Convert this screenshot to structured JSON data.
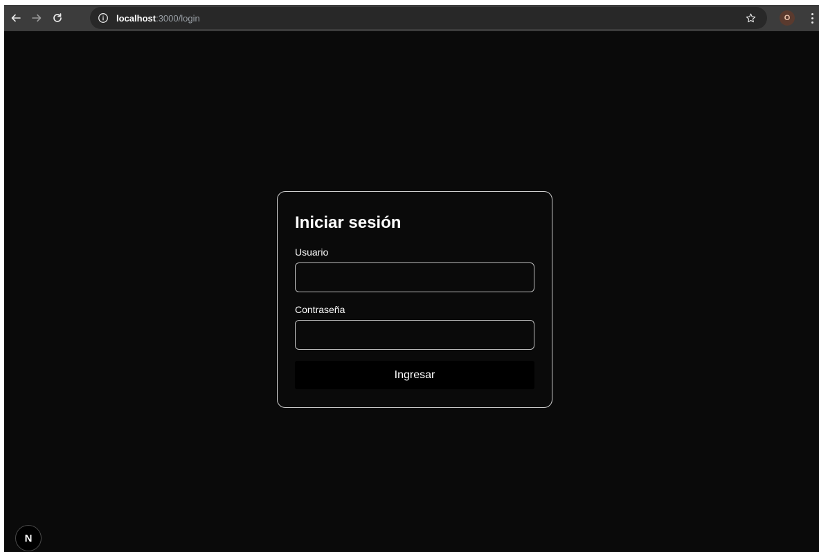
{
  "browser": {
    "url_host": "localhost",
    "url_path": ":3000/login",
    "profile_initial": "O",
    "colors": {
      "toolbar": "#3c3c3c",
      "omnibox": "#282828",
      "profile": "#5a3a2e"
    },
    "icons": [
      "back-arrow-icon",
      "forward-arrow-icon",
      "reload-icon",
      "info-icon",
      "star-icon",
      "kebab-menu-icon"
    ]
  },
  "login": {
    "title": "Iniciar sesión",
    "username_label": "Usuario",
    "username_value": "",
    "password_label": "Contraseña",
    "password_value": "",
    "submit_label": "Ingresar"
  },
  "dev_badge": {
    "letter": "N"
  },
  "colors": {
    "page_background": "#0a0a0a",
    "card_border": "#cfcfcf",
    "button_background": "#000000",
    "text": "#ffffff"
  }
}
